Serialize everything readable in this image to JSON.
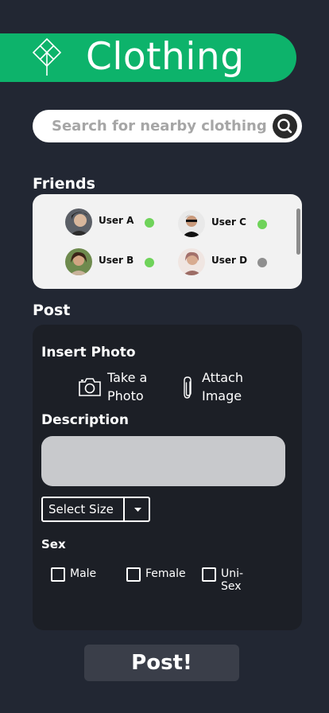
{
  "header": {
    "title": "Clothing",
    "logo_icon": "leaf-diamond-icon",
    "color": "#0db36b"
  },
  "search": {
    "placeholder": "Search for nearby clothing",
    "icon": "search-icon"
  },
  "friends": {
    "heading": "Friends",
    "users": [
      {
        "name": "User A",
        "status": "online",
        "status_color": "#6fd35a"
      },
      {
        "name": "User C",
        "status": "online",
        "status_color": "#6fd35a"
      },
      {
        "name": "User B",
        "status": "online",
        "status_color": "#6fd35a"
      },
      {
        "name": "User D",
        "status": "offline",
        "status_color": "#8f8f8f"
      }
    ]
  },
  "post": {
    "heading": "Post",
    "insert_photo_label": "Insert Photo",
    "take_photo_label": "Take a\nPhoto",
    "take_photo_icon": "camera-icon",
    "attach_image_label": "Attach\nImage",
    "attach_image_icon": "paperclip-icon",
    "description_label": "Description",
    "size_select": {
      "selected": "Select Size",
      "icon": "caret-down-icon"
    },
    "sex_label": "Sex",
    "sex_options": [
      "Male",
      "Female",
      "Uni-Sex"
    ],
    "submit_label": "Post!"
  }
}
